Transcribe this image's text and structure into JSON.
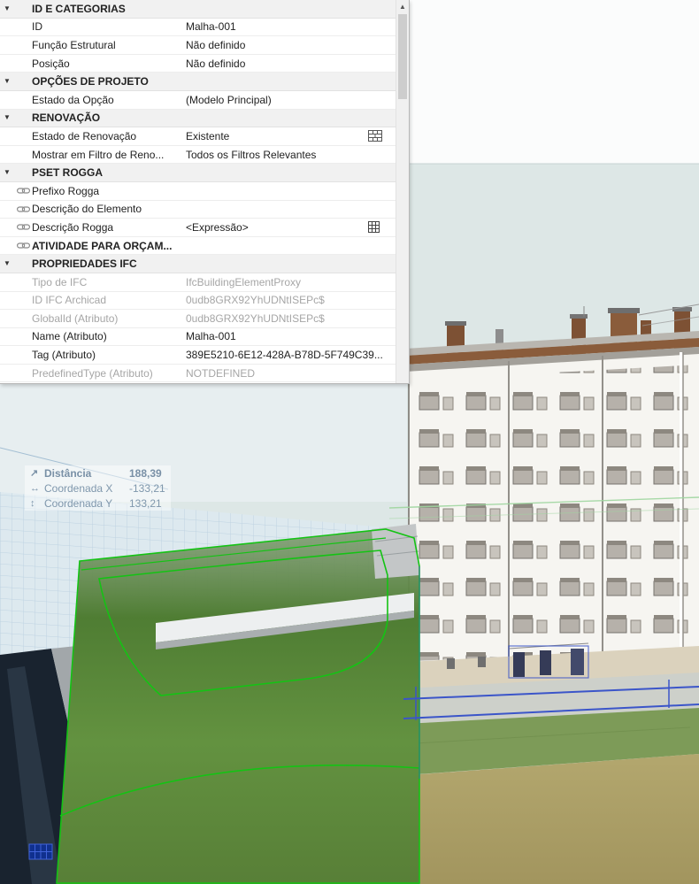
{
  "panel": {
    "rows": [
      {
        "kind": "header",
        "label": "ID E CATEGORIAS"
      },
      {
        "kind": "prop",
        "label": "ID",
        "value": "Malha-001"
      },
      {
        "kind": "prop",
        "label": "Função Estrutural",
        "value": "Não definido"
      },
      {
        "kind": "prop",
        "label": "Posição",
        "value": "Não definido"
      },
      {
        "kind": "header",
        "label": "OPÇÕES DE PROJETO"
      },
      {
        "kind": "prop",
        "label": "Estado da Opção",
        "value": "(Modelo Principal)"
      },
      {
        "kind": "header",
        "label": "RENOVAÇÃO"
      },
      {
        "kind": "prop",
        "label": "Estado de Renovação",
        "value": "Existente",
        "righticon": "brick-wall-icon"
      },
      {
        "kind": "prop",
        "label": "Mostrar em Filtro de Reno...",
        "value": "Todos os Filtros Relevantes"
      },
      {
        "kind": "header",
        "label": "PSET ROGGA"
      },
      {
        "kind": "chain",
        "label": "Prefixo Rogga",
        "value": ""
      },
      {
        "kind": "chain",
        "label": "Descrição do Elemento",
        "value": ""
      },
      {
        "kind": "chain",
        "label": "Descrição Rogga",
        "value": "<Expressão>",
        "righticon": "table-grid-icon"
      },
      {
        "kind": "chain",
        "label": "ATIVIDADE PARA ORÇAM...",
        "value": ""
      },
      {
        "kind": "header",
        "label": "PROPRIEDADES IFC"
      },
      {
        "kind": "gray",
        "label": "Tipo de IFC",
        "value": "IfcBuildingElementProxy"
      },
      {
        "kind": "gray",
        "label": "ID IFC Archicad",
        "value": "0udb8GRX92YhUDNtISEPc$"
      },
      {
        "kind": "gray",
        "label": "GlobalId (Atributo)",
        "value": "0udb8GRX92YhUDNtISEPc$"
      },
      {
        "kind": "prop",
        "label": "Name (Atributo)",
        "value": "Malha-001"
      },
      {
        "kind": "prop",
        "label": "Tag (Atributo)",
        "value": "389E5210-6E12-428A-B78D-5F749C39..."
      },
      {
        "kind": "gray",
        "label": "PredefinedType (Atributo)",
        "value": "NOTDEFINED"
      }
    ]
  },
  "icons": {
    "collapse": "▼",
    "scroll_up": "▲"
  },
  "measurements": {
    "icons": {
      "distance": "↗",
      "coord_x": "↔",
      "coord_y": "↕"
    },
    "distance_label": "Distância",
    "distance_value": "188,39",
    "coord_x_label": "Coordenada X",
    "coord_x_value": "-133,21",
    "coord_y_label": "Coordenada Y",
    "coord_y_value": "133,21"
  },
  "colors": {
    "selection_green": "#14c314",
    "selection_blue": "#3b55c9",
    "sky": "#dde7e6",
    "panel_bg": "#ffffff",
    "readonly_text": "#a6a6a6"
  }
}
